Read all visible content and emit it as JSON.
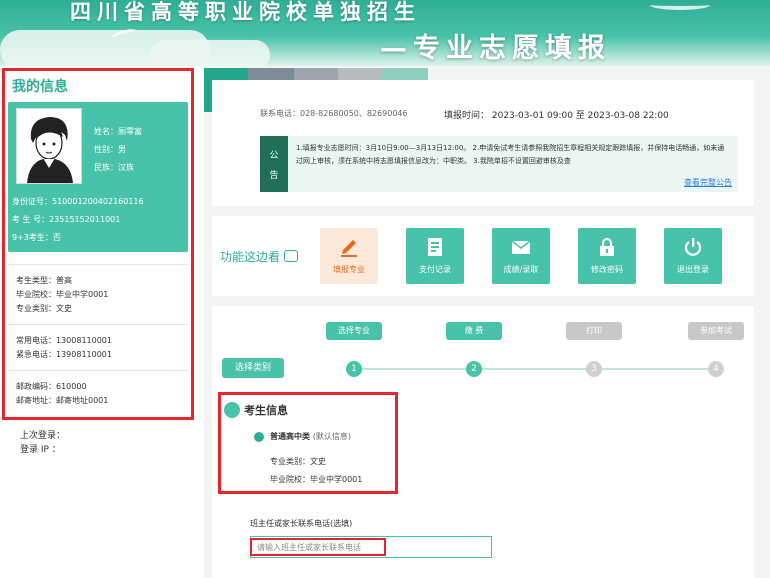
{
  "banner": {
    "title": "四川省高等职业院校单独招生",
    "subtitle": "—专业志愿填报"
  },
  "sidebar": {
    "title": "我的信息",
    "profile": {
      "name": "姓名：厕零富",
      "gender": "性别：男",
      "ethnicity": "民族：汉族",
      "id_number": "身份证号：510001200402160116",
      "exam_number": "考 生 号：23515152011001",
      "nine_plus_three": "9+3考生：否"
    },
    "academic": {
      "candidate_type": "考生类型：普高",
      "school": "毕业院校：毕业中学0001",
      "major_category": "专业类别：文史"
    },
    "phones": {
      "common": "常用电话：13008110001",
      "emergency": "紧急电话：13908110001"
    },
    "mail": {
      "postal_code": "邮政编码：610000",
      "address": "邮寄地址：邮寄地址0001"
    },
    "last_login": "上次登录：",
    "login_ip": "登录 IP ："
  },
  "top": {
    "contact": "联系电话：028-82680050、82690046",
    "fill_time": "填报时间： 2023-03-01 09:00 至 2023-03-08 22:00",
    "notice_badge_1": "公",
    "notice_badge_2": "告",
    "notice_text": "1.填报专业志愿时间：3月10日9:00—3月13日12:00。 2.申请免试考生请参照我院招生章程相关规定跟踪填报，并保持电话畅通，如未通过网上审核，须在系统中将志愿填报信息改为：中职类。 3.我院单招不设置回避审核及查",
    "notice_link": "查看完整公告"
  },
  "functions": {
    "label": "功能这边看",
    "buttons": [
      {
        "label": "填报专业"
      },
      {
        "label": "支付记录"
      },
      {
        "label": "成绩/录取"
      },
      {
        "label": "修改密码"
      },
      {
        "label": "退出登录"
      }
    ]
  },
  "steps": {
    "select_type": "选择类别",
    "items": [
      {
        "label": "选择专业",
        "num": "1"
      },
      {
        "label": "缴 费",
        "num": "2"
      },
      {
        "label": "打印",
        "num": "3"
      },
      {
        "label": "参加考试",
        "num": "4"
      }
    ]
  },
  "candidate": {
    "title": "考生信息",
    "type_main": "普通高中类",
    "type_note": "(默认信息)",
    "major_category": "专业类别：文史",
    "school": "毕业院校：毕业中学0001"
  },
  "phone_field": {
    "label": "班主任或家长联系电话(选填)",
    "placeholder": "请输入班主任或家长联系电话"
  },
  "colors": {
    "accent": "#48c2a8",
    "accent_dark": "#2fae95",
    "highlight": "#e8242d",
    "step_inactive": "#c8c8c8"
  }
}
